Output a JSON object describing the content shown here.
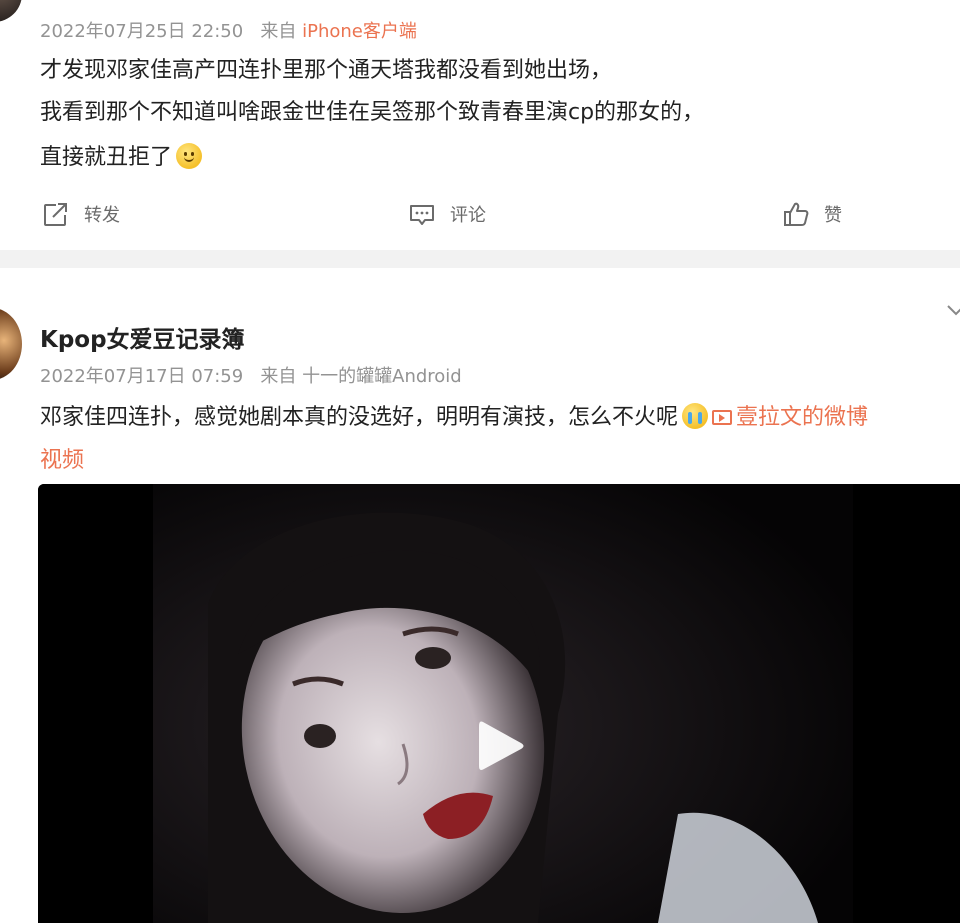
{
  "post1": {
    "timestamp": "2022年07月25日 22:50",
    "from_label": "来自",
    "source": "iPhone客户端",
    "lines": [
      "才发现邓家佳高产四连扑里那个通天塔我都没看到她出场，",
      "我看到那个不知道叫啥跟金世佳在吴签那个致青春里演cp的那女的，",
      "直接就丑拒了"
    ],
    "actions": {
      "repost": "转发",
      "comment": "评论",
      "like": "赞"
    }
  },
  "post2": {
    "username": "Kpop女爱豆记录簿",
    "timestamp": "2022年07月17日 07:59",
    "from_label": "来自",
    "source": "十一的罐罐Android",
    "text": "邓家佳四连扑，感觉她剧本真的没选好，明明有演技，怎么不火呢",
    "link_line1": "壹拉文的微博",
    "link_line2": "视频"
  },
  "colors": {
    "accent": "#eb7350",
    "meta": "#939393",
    "text": "#222222",
    "separator": "#f2f2f2"
  },
  "icons": {
    "repost": "share-arrow-icon",
    "comment": "comment-icon",
    "like": "thumbs-up-icon",
    "more": "chevron-down-icon",
    "video": "play-icon"
  }
}
